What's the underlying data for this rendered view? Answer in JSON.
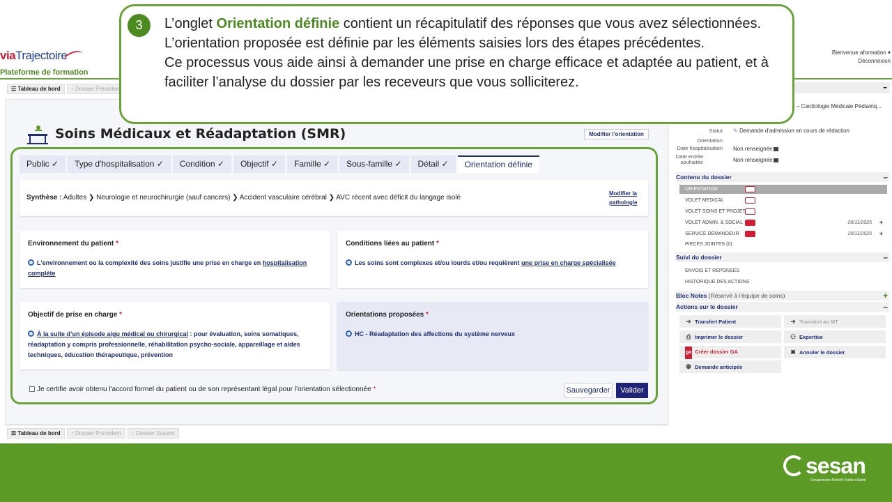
{
  "header": {
    "logo_via": "via",
    "logo_rest": "Trajectoire",
    "platform": "Plateforme de formation",
    "welcome": "Bienvenue aformation ▾",
    "logout": "Déconnexion"
  },
  "toolbar": {
    "dashboard": "☰ Tableau de bord",
    "previous": "↑ Dossier Précédent",
    "next": "↓ Dossier Suivant"
  },
  "callout": {
    "step": "3",
    "line1_pre": "L’onglet ",
    "line1_hl": "Orientation définie",
    "line1_post": " contient un récapitulatif des réponses que vous avez sélectionnées. L’orientation proposée est définie par les éléments saisies lors des étapes précédentes.",
    "line2": "Ce processus vous aide ainsi à demander une prise en charge efficace et adaptée au patient, et à faciliter l’analyse du dossier par les receveurs que vous solliciterez."
  },
  "main": {
    "title": "Soins Médicaux et Réadaptation (SMR)",
    "modify_orientation": "Modifier l'orientation",
    "tabs": [
      {
        "label": "Public ✓"
      },
      {
        "label": "Type d'hospitalisation ✓"
      },
      {
        "label": "Condition ✓"
      },
      {
        "label": "Objectif ✓"
      },
      {
        "label": "Famille ✓"
      },
      {
        "label": "Sous-famille ✓"
      },
      {
        "label": "Détail ✓"
      },
      {
        "label": "Orientation définie"
      }
    ],
    "synthesis_label": "Synthèse :",
    "synthesis_path": " Adultes ❯ Neurologie et neurochirurgie (sauf cancers) ❯ Accident vasculaire cérébral ❯ AVC récent avec déficit du langage isolé",
    "modify_pathology": "Modifier la pathologie",
    "cards": {
      "env": {
        "title": "Environnement du patient",
        "choice_u": "",
        "choice": "L'environnement ou la complexité des soins justifie une prise en charge en ",
        "choice_u2": "hospitalisation complète"
      },
      "cond": {
        "title": "Conditions liées au patient",
        "choice": "Les soins sont complexes et/ou lourds et/ou requièrent ",
        "choice_u": "une prise en charge spécialisée"
      },
      "obj": {
        "title": "Objectif de prise en charge",
        "choice_u": "À la suite d’un épisode aigu médical ou chirurgical",
        "choice": " : pour évaluation, soins somatiques, réadaptation y compris professionnelle, réhabilitation psycho-sociale, appareillage et aides techniques, éducation thérapeutique, prévention"
      },
      "orient": {
        "title": "Orientations proposées",
        "choice": "HC - Réadaptation des affections du système nerveux"
      }
    },
    "required_mark": "*",
    "certify": "Je certifie avoir obtenu l'accord formel du patient ou de son représentant légal pour l'orientation sélectionnée",
    "save": "Sauvegarder",
    "validate": "Valider"
  },
  "sidebar": {
    "referral": "– Cardiologie Médicale Pédiatriq...",
    "info": [
      {
        "label": "Statut",
        "value": "Demande d'admission en cours de rédaction"
      },
      {
        "label": "Orientation",
        "value": ""
      },
      {
        "label": "Date hospitalisation",
        "value": "Non renseignée"
      },
      {
        "label": "Date entrée souhaitée",
        "value": "Non renseignée"
      }
    ],
    "contents_title": "Contenu du dossier",
    "contents": [
      {
        "label": "ORIENTATION",
        "date": ""
      },
      {
        "label": "VOLET MEDICAL",
        "date": ""
      },
      {
        "label": "VOLET SOINS ET PROJET",
        "date": ""
      },
      {
        "label": "VOLET ADMIN. & SOCIAL",
        "date": "20/11/2025"
      },
      {
        "label": "SERVICE DEMANDEUR",
        "date": "20/11/2025"
      },
      {
        "label": "PIECES JOINTES (0)",
        "date": ""
      }
    ],
    "followup_title": "Suivi du dossier",
    "followup": [
      "ENVOIS ET REPONSES",
      "HISTORIQUE DES ACTIONS"
    ],
    "notes_title": "Bloc Notes",
    "notes_sub": " (Réservé à l'équipe de soins)",
    "actions_title": "Actions sur le dossier",
    "actions": {
      "transfer": "Transfert Patient",
      "transfer_mt": "Transfert au MT",
      "print": "Imprimer le dossier",
      "expertise": "Expertise",
      "create_ga": "Créer dossier GA",
      "cancel": "Annuler le dossier",
      "anticipated": "Demande anticipée"
    }
  },
  "footer": {
    "brand": "sesan",
    "tagline": "Groupement d'Intérêt Public eSanté"
  }
}
